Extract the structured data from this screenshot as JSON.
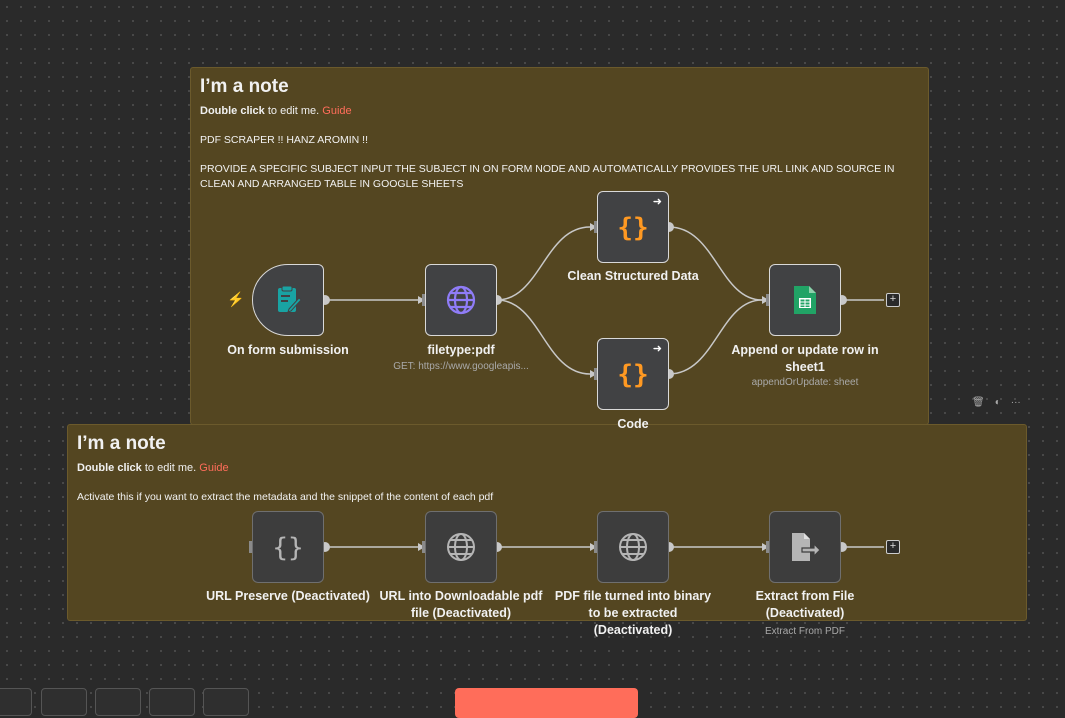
{
  "note1": {
    "title": "I’m a note",
    "edit_bold": "Double click",
    "edit_rest": " to edit me. ",
    "guide": "Guide",
    "para1": "PDF SCRAPER !! HANZ AROMIN !!",
    "para2": "PROVIDE A SPECIFIC SUBJECT INPUT THE SUBJECT IN ON FORM NODE AND AUTOMATICALLY PROVIDES THE URL LINK AND SOURCE IN CLEAN AND ARRANGED TABLE IN GOOGLE SHEETS"
  },
  "note2": {
    "title": "I’m a note",
    "edit_bold": "Double click",
    "edit_rest": " to edit me. ",
    "guide": "Guide",
    "para1": "Activate this if you want to extract the metadata and the snippet of the content of each pdf"
  },
  "nodes": {
    "form": {
      "label": "On form submission",
      "icon": "form-icon"
    },
    "filetype": {
      "label": "filetype:pdf",
      "sub": "GET: https://www.googleapis...",
      "icon": "globe-icon"
    },
    "clean": {
      "label": "Clean Structured Data",
      "icon": "code-braces-icon"
    },
    "code": {
      "label": "Code",
      "icon": "code-braces-icon"
    },
    "sheets": {
      "label": "Append or update row in sheet1",
      "sub": "appendOrUpdate: sheet",
      "icon": "google-sheets-icon"
    },
    "url_preserve": {
      "label": "URL Preserve (Deactivated)",
      "icon": "code-braces-icon"
    },
    "url_download": {
      "label": "URL into Downloadable pdf file (Deactivated)",
      "icon": "globe-icon"
    },
    "pdf_binary": {
      "label": "PDF file turned into binary to be extracted (Deactivated)",
      "icon": "globe-icon"
    },
    "extract": {
      "label": "Extract from File (Deactivated)",
      "sub": "Extract From PDF",
      "icon": "extract-file-icon"
    }
  },
  "colors": {
    "canvas": "#2a2a2a",
    "note": "#544621",
    "accent": "#ff6d5a",
    "code_orange": "#ff9922",
    "globe_purple": "#8f7cf8",
    "form_teal": "#19a3a3",
    "sheets_green": "#21a366"
  }
}
